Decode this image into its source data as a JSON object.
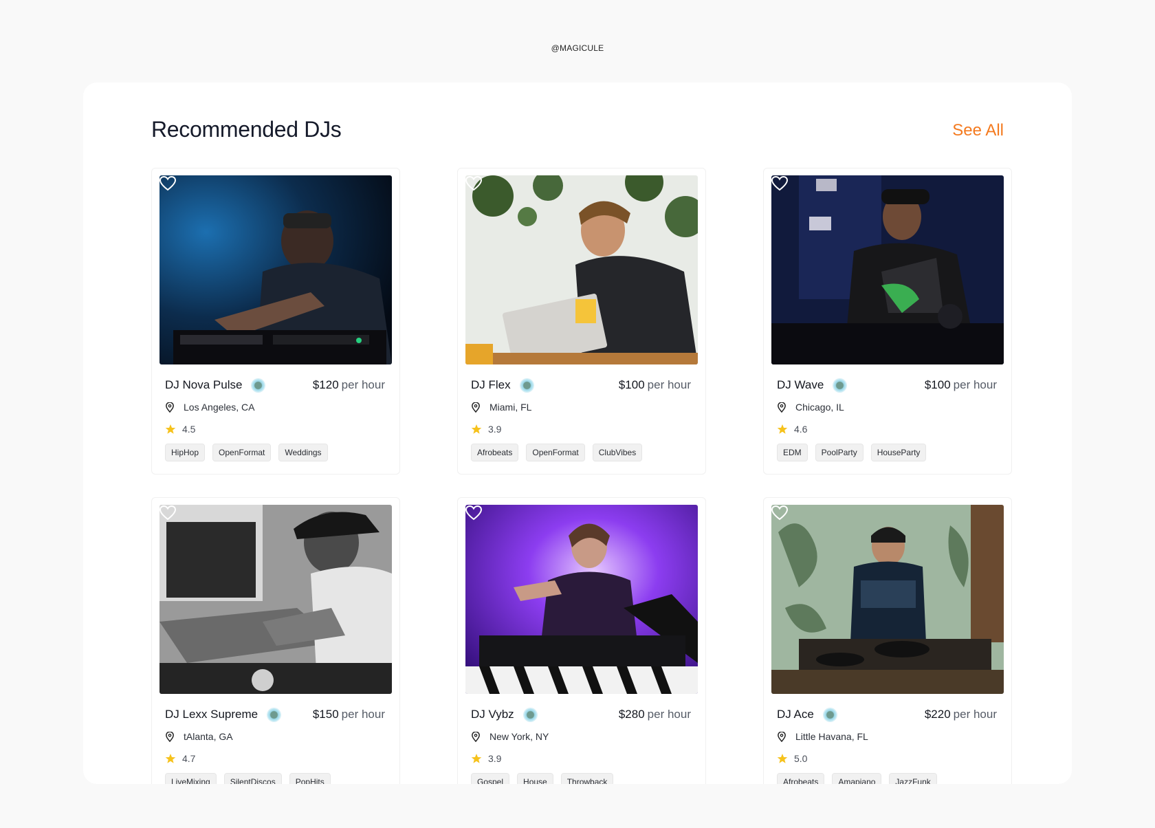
{
  "brand": "@MAGICULE",
  "section": {
    "title": "Recommended DJs",
    "see_all_label": "See All"
  },
  "price_unit": "per hour",
  "djs": [
    {
      "name": "DJ Nova Pulse",
      "price": "$120",
      "location": "Los Angeles, CA",
      "rating": "4.5",
      "tags": [
        "HipHop",
        "OpenFormat",
        "Weddings"
      ]
    },
    {
      "name": "DJ Flex",
      "price": "$100",
      "location": "Miami, FL",
      "rating": "3.9",
      "tags": [
        "Afrobeats",
        "OpenFormat",
        "ClubVibes"
      ]
    },
    {
      "name": "DJ Wave",
      "price": "$100",
      "location": "Chicago, IL",
      "rating": "4.6",
      "tags": [
        "EDM",
        "PoolParty",
        "HouseParty"
      ]
    },
    {
      "name": "DJ Lexx Supreme",
      "price": "$150",
      "location": "tAlanta, GA",
      "rating": "4.7",
      "tags": [
        "LiveMixing",
        "SilentDiscos",
        "PopHits"
      ]
    },
    {
      "name": "DJ Vybz",
      "price": "$280",
      "location": "New York, NY",
      "rating": "3.9",
      "tags": [
        "Gospel",
        "House",
        "Throwback"
      ]
    },
    {
      "name": "DJ Ace",
      "price": "$220",
      "location": "Little Havana, FL",
      "rating": "5.0",
      "tags": [
        "Afrobeats",
        "Amapiano",
        "JazzFunk"
      ]
    }
  ],
  "colors": {
    "accent": "#f47a1f",
    "star": "#f6c21c",
    "background": "#f9f9f9",
    "panel": "#ffffff"
  },
  "icons": {
    "favorite": "heart-icon",
    "location": "location-pin-icon",
    "rating": "star-icon",
    "verified": "verified-badge-icon"
  }
}
